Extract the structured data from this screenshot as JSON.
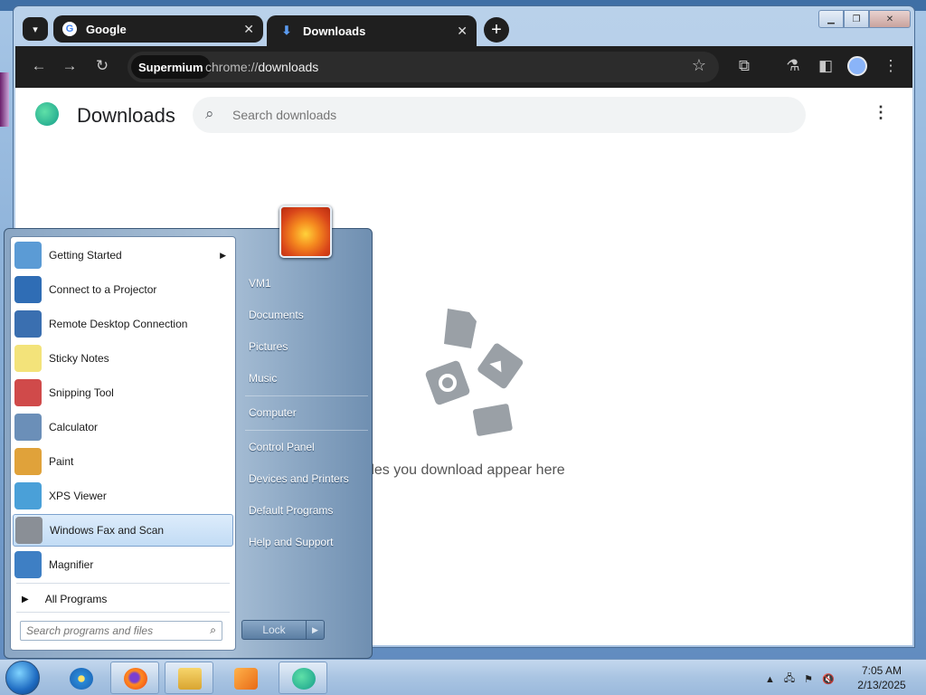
{
  "browser": {
    "tabs": [
      {
        "label": "Google",
        "close": "✕"
      },
      {
        "label": "Downloads",
        "close": "✕"
      }
    ],
    "new_tab": "+",
    "toolbar": {
      "profile_chip": "Supermium",
      "url_scheme": "chrome://",
      "url_path": "downloads"
    },
    "page": {
      "title": "Downloads",
      "search_placeholder": "Search downloads",
      "empty_message": "Files you download appear here"
    }
  },
  "start_menu": {
    "programs": [
      {
        "label": "Getting Started",
        "icon": "getting-started-icon",
        "has_submenu": true,
        "color": "#5b9bd5"
      },
      {
        "label": "Connect to a Projector",
        "icon": "projector-icon",
        "has_submenu": false,
        "color": "#2f6db5"
      },
      {
        "label": "Remote Desktop Connection",
        "icon": "remote-desktop-icon",
        "has_submenu": false,
        "color": "#3a6fb0"
      },
      {
        "label": "Sticky Notes",
        "icon": "sticky-notes-icon",
        "has_submenu": false,
        "color": "#f3e37a"
      },
      {
        "label": "Snipping Tool",
        "icon": "snipping-tool-icon",
        "has_submenu": false,
        "color": "#d04a4a"
      },
      {
        "label": "Calculator",
        "icon": "calculator-icon",
        "has_submenu": false,
        "color": "#6b8fb8"
      },
      {
        "label": "Paint",
        "icon": "paint-icon",
        "has_submenu": false,
        "color": "#e0a23a"
      },
      {
        "label": "XPS Viewer",
        "icon": "xps-viewer-icon",
        "has_submenu": false,
        "color": "#4aa0d8"
      },
      {
        "label": "Windows Fax and Scan",
        "icon": "fax-scan-icon",
        "has_submenu": false,
        "color": "#8a8f96",
        "selected": true
      },
      {
        "label": "Magnifier",
        "icon": "magnifier-icon",
        "has_submenu": false,
        "color": "#3e7fc4"
      }
    ],
    "all_programs": "All Programs",
    "search_placeholder": "Search programs and files",
    "right": [
      "VM1",
      "Documents",
      "Pictures",
      "Music",
      "Computer",
      "Control Panel",
      "Devices and Printers",
      "Default Programs",
      "Help and Support"
    ],
    "lock_label": "Lock"
  },
  "taskbar": {
    "pinned": [
      "internet-explorer-icon",
      "firefox-icon",
      "explorer-icon",
      "media-player-icon",
      "supermium-icon"
    ],
    "clock_time": "7:05 AM",
    "clock_date": "2/13/2025"
  }
}
